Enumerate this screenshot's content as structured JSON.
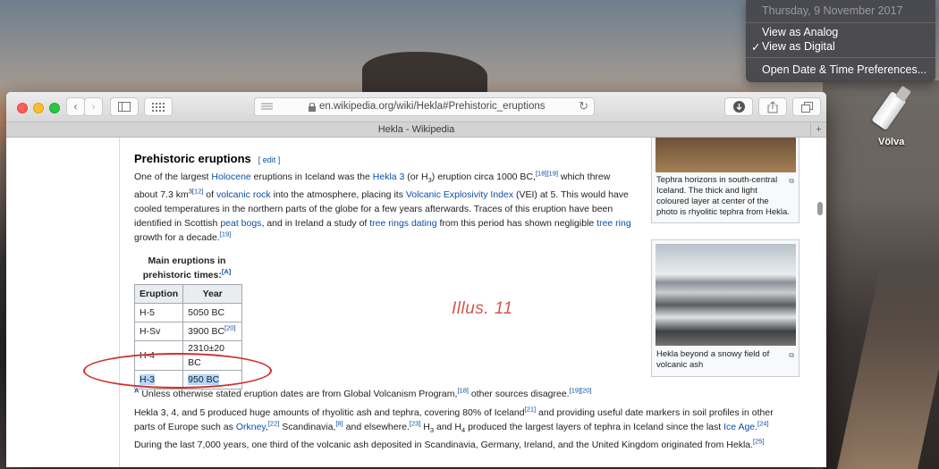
{
  "menu": {
    "date": "Thursday, 9 November 2017",
    "items": [
      "View as Analog",
      "View as Digital",
      "Open Date & Time Preferences..."
    ],
    "checked": "View as Digital"
  },
  "desktop": {
    "drive_label": "Völva"
  },
  "browser": {
    "url": "en.wikipedia.org/wiki/Hekla#Prehistoric_eruptions",
    "tab_title": "Hekla - Wikipedia",
    "new_tab": "+"
  },
  "article": {
    "heading": "Prehistoric eruptions",
    "edit": "[ edit ]",
    "para1": {
      "s1": "One of the largest ",
      "l1": "Holocene",
      "s2": " eruptions in Iceland was the ",
      "l2": "Hekla 3",
      "s3": " (or H",
      "sub3": "3",
      "s4": ") eruption circa 1000 BC,",
      "r1": "[18][19]",
      "s5": " which threw about 7.3 km",
      "sup5": "3",
      "r2": "[12]",
      "s6": " of ",
      "l3": "volcanic rock",
      "s7": " into the atmosphere, placing its ",
      "l4": "Volcanic Explosivity Index",
      "s8": " (VEI) at 5. This would have cooled temperatures in the northern parts of the globe for a few years afterwards. Traces of this eruption have been identified in Scottish ",
      "l5": "peat bogs",
      "s9": ", and in Ireland a study of ",
      "l6": "tree rings dating",
      "s10": " from this period has shown negligible ",
      "l7": "tree ring",
      "s11": " growth for a decade.",
      "r3": "[19]"
    },
    "table": {
      "caption": "Main eruptions in prehistoric times:",
      "caption_ref": "[A]",
      "headers": [
        "Eruption",
        "Year"
      ],
      "rows": [
        {
          "eruption": "H-5",
          "year": "5050 BC",
          "ref": ""
        },
        {
          "eruption": "H-Sv",
          "year": "3900 BC",
          "ref": "[20]"
        },
        {
          "eruption": "H-4",
          "year": "2310±20 BC",
          "ref": ""
        },
        {
          "eruption": "H-3",
          "year": "950 BC",
          "ref": ""
        }
      ]
    },
    "footnote": {
      "mark": "A",
      "text": " Unless otherwise stated eruption dates are from Global Volcanism Program,",
      "r1": "[18]",
      "text2": " other sources disagree.",
      "r2": "[19][20]"
    },
    "para2": {
      "s1": "Hekla 3, 4, and 5 produced huge amounts of rhyolitic ash and tephra, covering 80% of Iceland",
      "r1": "[21]",
      "s2": " and providing useful date markers in soil profiles in other parts of Europe such as ",
      "l1": "Orkney",
      "r2": "[22]",
      "s3": " Scandinavia,",
      "r3": "[8]",
      "s4": " and elsewhere.",
      "r4": "[23]",
      "s5": " H",
      "sub5": "3",
      "s6": " and H",
      "sub6": "4",
      "s7": " produced the largest layers of tephra in Iceland since the last ",
      "l2": "Ice Age",
      "r5": "[24]",
      "s8": " During the last 7,000 years, one third of the volcanic ash deposited in Scandinavia, Germany, Ireland, and the United Kingdom originated from Hekla.",
      "r6": "[25]"
    },
    "thumb1_caption": "Tephra horizons in south-central Iceland. The thick and light coloured layer at center of the photo is rhyolitic tephra from Hekla.",
    "thumb2_caption": "Hekla beyond a snowy field of volcanic ash"
  },
  "annotation": {
    "label": "Illus. 11",
    "color": "#d2302c"
  }
}
